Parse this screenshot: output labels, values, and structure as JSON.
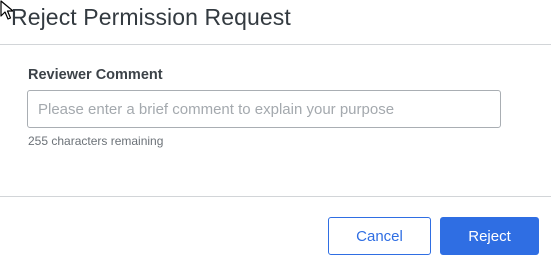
{
  "dialog": {
    "title": "Reject Permission Request",
    "field_label": "Reviewer Comment",
    "comment_value": "",
    "comment_placeholder": "Please enter a brief comment to explain your purpose",
    "chars_remaining": "255 characters remaining",
    "cancel_label": "Cancel",
    "reject_label": "Reject"
  },
  "colors": {
    "primary": "#2f6ee3",
    "divider": "#d2d5d8",
    "title_text": "#333a40"
  },
  "icons": {
    "cursor": "mouse-pointer-icon"
  }
}
